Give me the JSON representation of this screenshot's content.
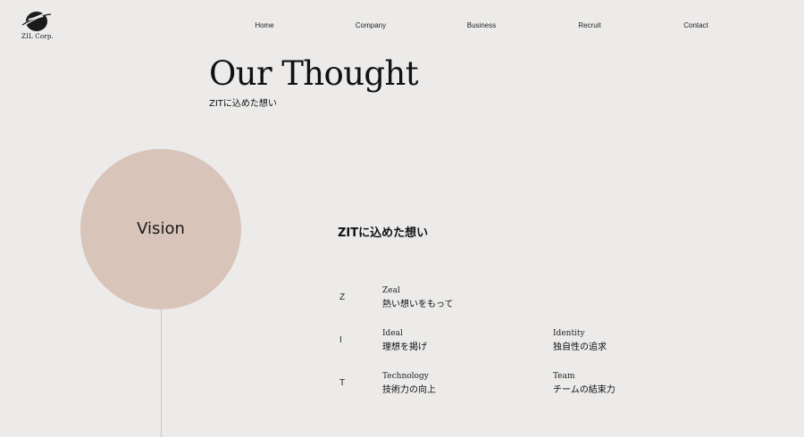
{
  "logo": {
    "text": "ZIL Corp."
  },
  "nav": {
    "items": [
      "Home",
      "Company",
      "Business",
      "Recruit",
      "Contact"
    ]
  },
  "hero": {
    "title": "Our Thought",
    "subtitle": "ZITに込めた想い"
  },
  "vision": {
    "label": "Vision"
  },
  "values": {
    "heading": "ZITに込めた想い",
    "letters": [
      "Z",
      "I",
      "T"
    ],
    "items": [
      {
        "en": "Zeal",
        "jp": "熱い想いをもって"
      },
      {
        "en": "Ideal",
        "jp": "理想を掲げ"
      },
      {
        "en": "Identity",
        "jp": "独自性の追求"
      },
      {
        "en": "Technology",
        "jp": "技術力の向上"
      },
      {
        "en": "Team",
        "jp": "チームの結束力"
      }
    ]
  },
  "colors": {
    "background": "#ecebea",
    "vision_circle": "#d8c4b9",
    "text": "#111111"
  }
}
